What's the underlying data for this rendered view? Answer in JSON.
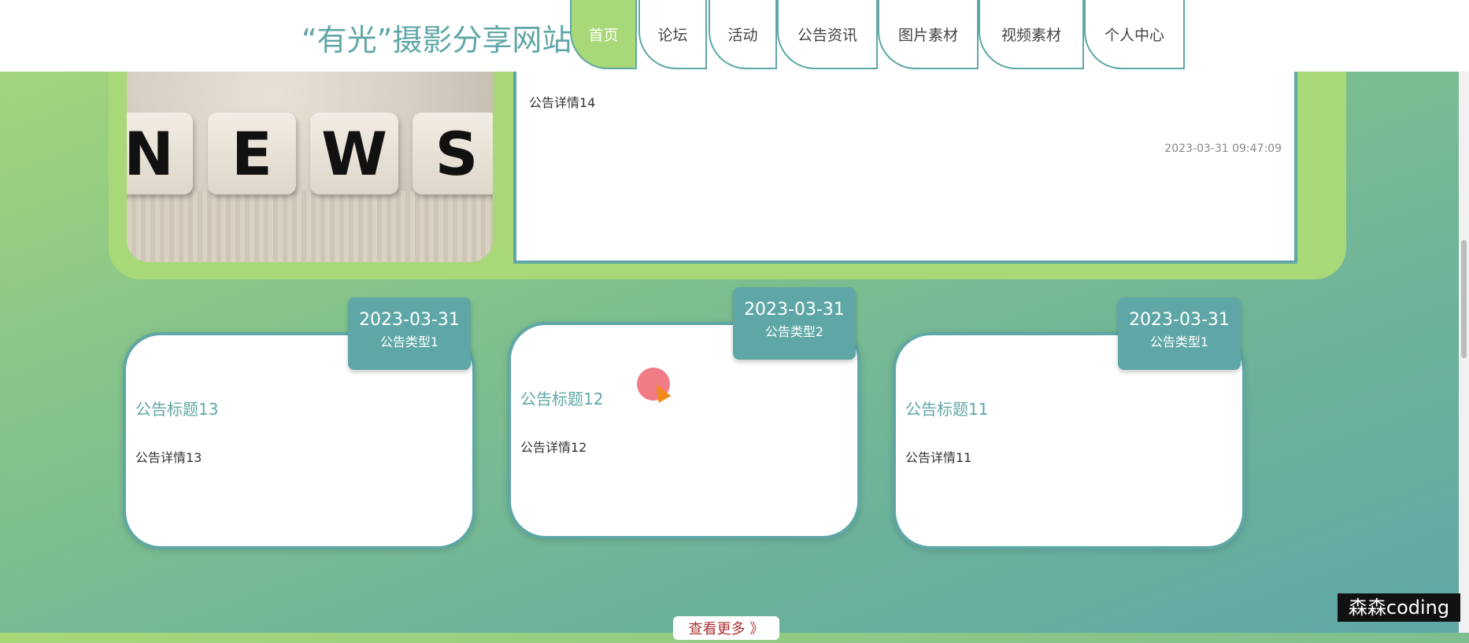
{
  "site": {
    "title": "“有光”摄影分享网站"
  },
  "nav": [
    {
      "label": "首页",
      "active": true
    },
    {
      "label": "论坛"
    },
    {
      "label": "活动"
    },
    {
      "label": "公告资讯"
    },
    {
      "label": "图片素材"
    },
    {
      "label": "视频素材"
    },
    {
      "label": "个人中心"
    }
  ],
  "featured": {
    "image_word": "NEWS",
    "letters": [
      "N",
      "E",
      "W",
      "S"
    ],
    "detail": "公告详情14",
    "time": "2023-03-31 09:47:09"
  },
  "cards": [
    {
      "date": "2023-03-31",
      "type": "公告类型1",
      "title": "公告标题13",
      "detail": "公告详情13"
    },
    {
      "date": "2023-03-31",
      "type": "公告类型2",
      "title": "公告标题12",
      "detail": "公告详情12"
    },
    {
      "date": "2023-03-31",
      "type": "公告类型1",
      "title": "公告标题11",
      "detail": "公告详情11"
    }
  ],
  "more_button": "查看更多 》",
  "watermark": "森森coding",
  "colors": {
    "accent": "#5fa7a6",
    "active": "#a8d878"
  }
}
